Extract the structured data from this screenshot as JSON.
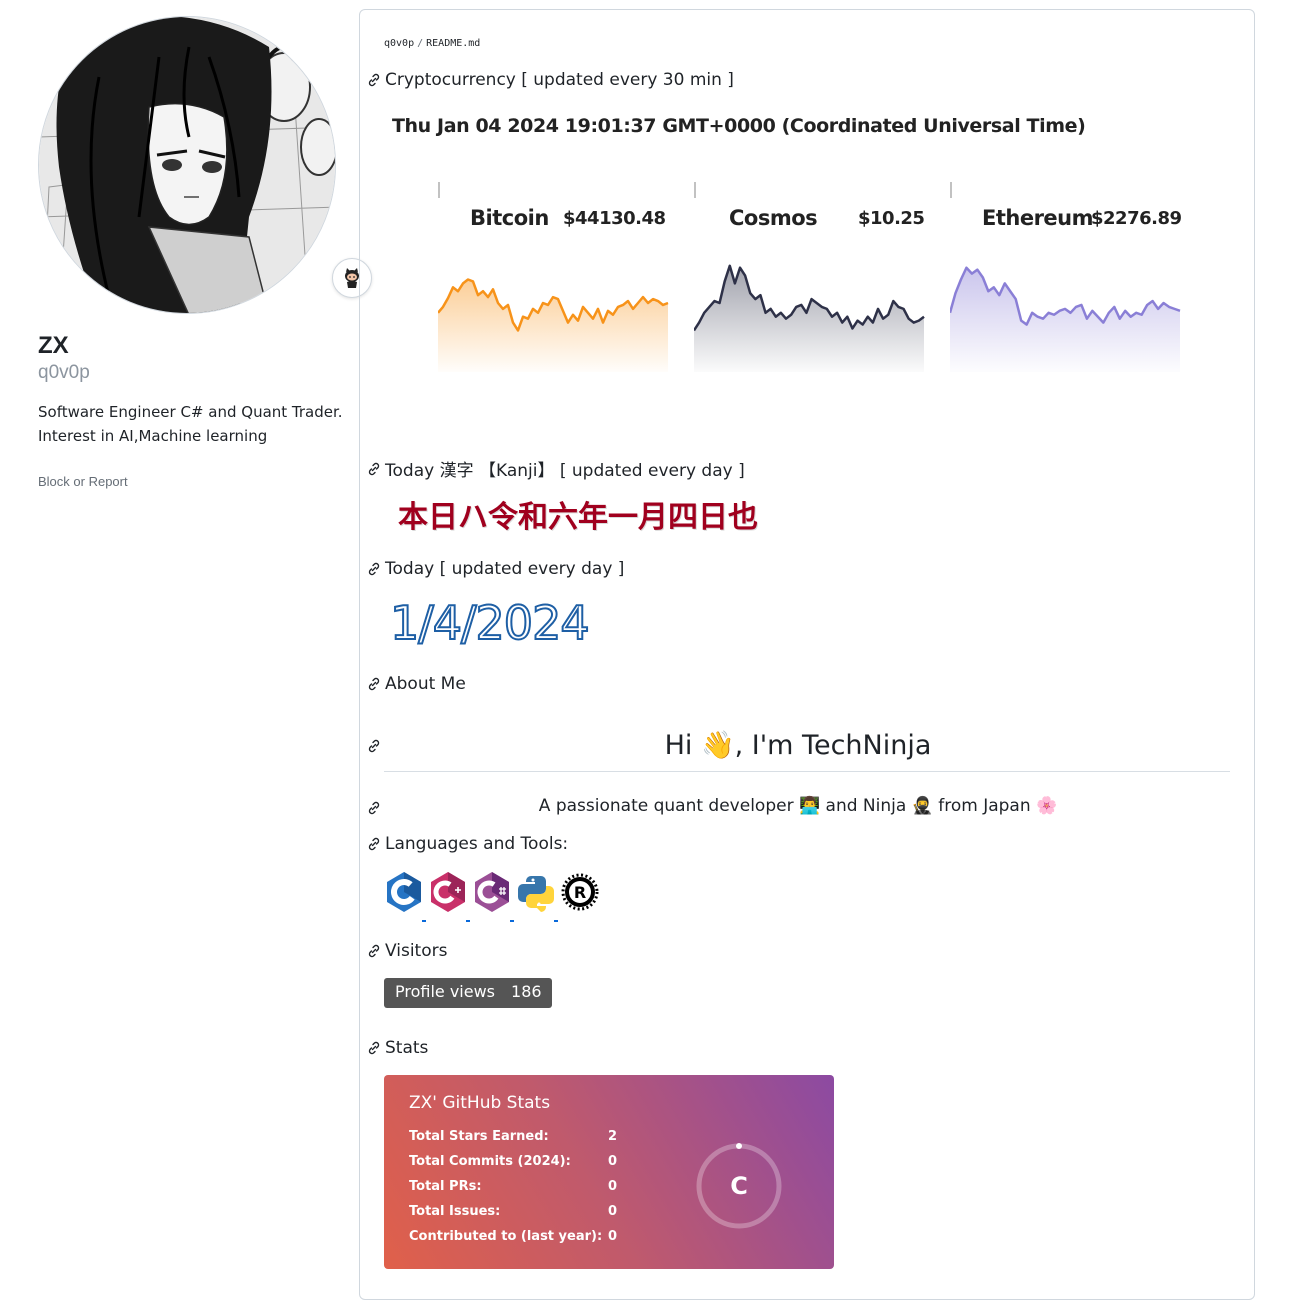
{
  "profile": {
    "name": "ZX",
    "login": "q0v0p",
    "bio_line1": "Software Engineer C# and Quant Trader.",
    "bio_line2": "Interest in AI,Machine learning",
    "block_report": "Block or Report",
    "status_icon": "octocat-icon"
  },
  "readme": {
    "path_user": "q0v0p",
    "path_sep": "/",
    "path_file": "README.md",
    "crypto_heading": "Cryptocurrency [ updated every 30 min ]",
    "datetime": "Thu Jan 04 2024 19:01:37 GMT+0000 (Coordinated Universal Time)",
    "coins": [
      {
        "name": "Bitcoin",
        "price": "$44130.48",
        "color": "#f7931a",
        "series": [
          40,
          46,
          55,
          66,
          62,
          70,
          74,
          72,
          58,
          62,
          56,
          64,
          50,
          44,
          48,
          30,
          22,
          36,
          34,
          44,
          40,
          50,
          48,
          56,
          54,
          42,
          30,
          38,
          32,
          46,
          40,
          34,
          44,
          30,
          42,
          38,
          46,
          48,
          52,
          44,
          50,
          56,
          50,
          54,
          52,
          48,
          50
        ]
      },
      {
        "name": "Cosmos",
        "price": "$10.25",
        "color": "#2e3148",
        "series": [
          22,
          30,
          40,
          46,
          52,
          50,
          72,
          88,
          70,
          86,
          78,
          60,
          54,
          58,
          40,
          44,
          36,
          40,
          34,
          38,
          46,
          48,
          40,
          54,
          50,
          46,
          44,
          36,
          40,
          30,
          36,
          24,
          32,
          28,
          36,
          30,
          44,
          34,
          38,
          52,
          46,
          44,
          34,
          30,
          32,
          36
        ]
      },
      {
        "name": "Ethereum",
        "price": "$2276.89",
        "color": "#8a7fd6",
        "series": [
          40,
          60,
          74,
          86,
          80,
          84,
          76,
          62,
          66,
          58,
          70,
          62,
          54,
          32,
          28,
          40,
          36,
          34,
          40,
          38,
          42,
          44,
          40,
          46,
          48,
          34,
          42,
          36,
          30,
          40,
          46,
          34,
          42,
          36,
          40,
          38,
          48,
          52,
          44,
          50,
          46,
          44,
          42
        ]
      }
    ],
    "kanji_heading": "Today 漢字 【Kanji】 [ updated every day ]",
    "kanji_text": "本日ハ令和六年一月四日也",
    "today_heading": "Today [ updated every day ]",
    "today_date": "1/4/2024",
    "about_heading": "About Me",
    "hi_text": "Hi 👋, I'm TechNinja",
    "passion_text": "A passionate quant developer 👨‍💻 and Ninja 🥷 from Japan 🌸",
    "languages_heading": "Languages and Tools:",
    "languages": [
      "c-icon",
      "cplusplus-icon",
      "csharp-icon",
      "python-icon",
      "rust-icon"
    ],
    "visitors_heading": "Visitors",
    "badge_label": "Profile views",
    "badge_value": "186",
    "stats_heading": "Stats",
    "stats": {
      "title": "ZX' GitHub Stats",
      "rows": [
        {
          "label": "Total Stars Earned:",
          "value": "2"
        },
        {
          "label": "Total Commits (2024):",
          "value": "0"
        },
        {
          "label": "Total PRs:",
          "value": "0"
        },
        {
          "label": "Total Issues:",
          "value": "0"
        },
        {
          "label": "Contributed to (last year):",
          "value": "0"
        }
      ],
      "rank": "C"
    }
  }
}
